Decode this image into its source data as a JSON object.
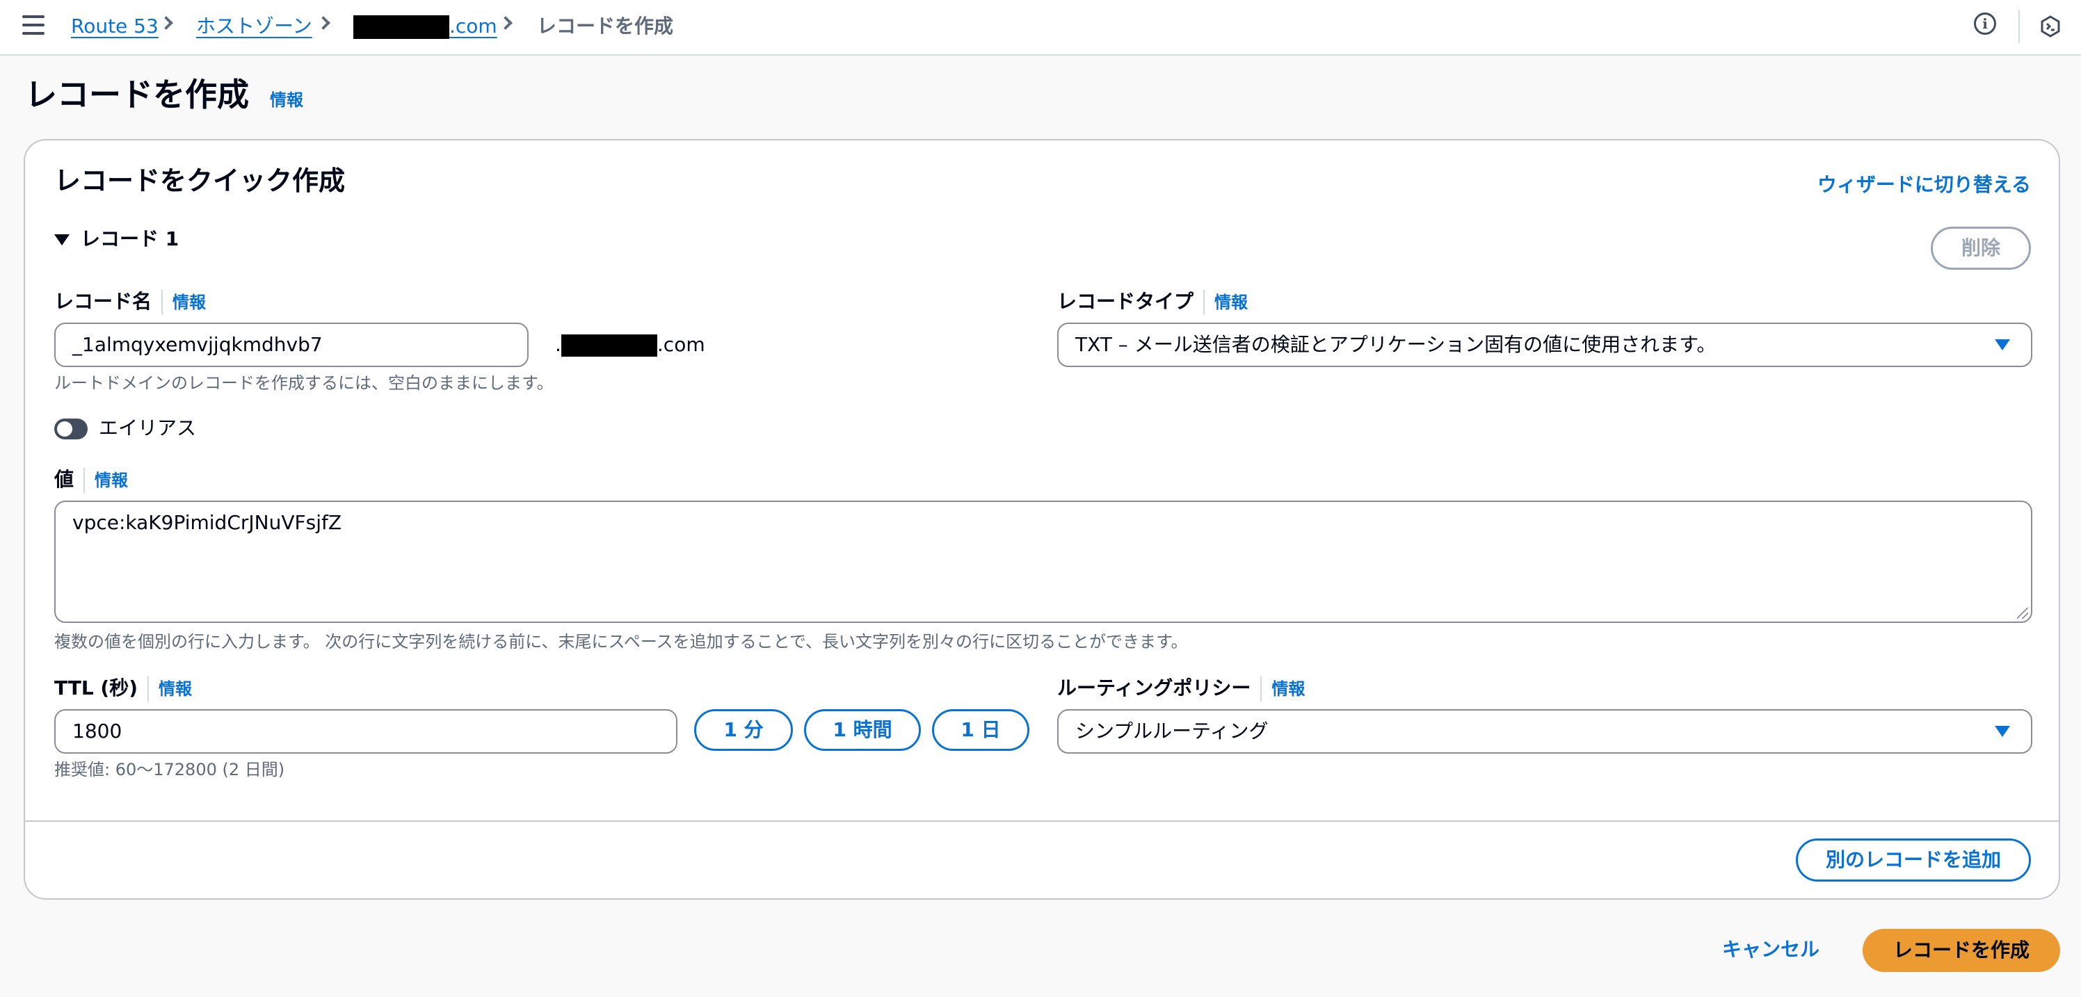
{
  "breadcrumb": {
    "items": [
      "Route 53",
      "ホストゾーン",
      ".com",
      "レコードを作成"
    ]
  },
  "page": {
    "title": "レコードを作成",
    "info": "情報"
  },
  "section": {
    "title": "レコードをクイック作成",
    "wizard_link": "ウィザードに切り替える",
    "record_header": "レコード 1",
    "delete_label": "削除"
  },
  "record_name": {
    "label": "レコード名",
    "info": "情報",
    "value": "_1almqyxemvjjqkmdhvb7",
    "domain_suffix": ".com",
    "hint": "ルートドメインのレコードを作成するには、空白のままにします。"
  },
  "record_type": {
    "label": "レコードタイプ",
    "info": "情報",
    "value": "TXT – メール送信者の検証とアプリケーション固有の値に使用されます。"
  },
  "alias": {
    "label": "エイリアス",
    "enabled": false
  },
  "value": {
    "label": "値",
    "info": "情報",
    "text": "vpce:kaK9PimidCrJNuVFsjfZ",
    "hint": "複数の値を個別の行に入力します。 次の行に文字列を続ける前に、末尾にスペースを追加することで、長い文字列を別々の行に区切ることができます。"
  },
  "ttl": {
    "label": "TTL (秒)",
    "info": "情報",
    "value": "1800",
    "presets": [
      "1 分",
      "1 時間",
      "1 日"
    ],
    "hint": "推奨値: 60〜172800 (2 日間)"
  },
  "routing_policy": {
    "label": "ルーティングポリシー",
    "info": "情報",
    "value": "シンプルルーティング"
  },
  "footer": {
    "add_record": "別のレコードを追加",
    "cancel": "キャンセル",
    "create": "レコードを作成"
  },
  "colors": {
    "link": "#0972d3",
    "primary": "#ec9b32",
    "border": "#8c8c94"
  }
}
